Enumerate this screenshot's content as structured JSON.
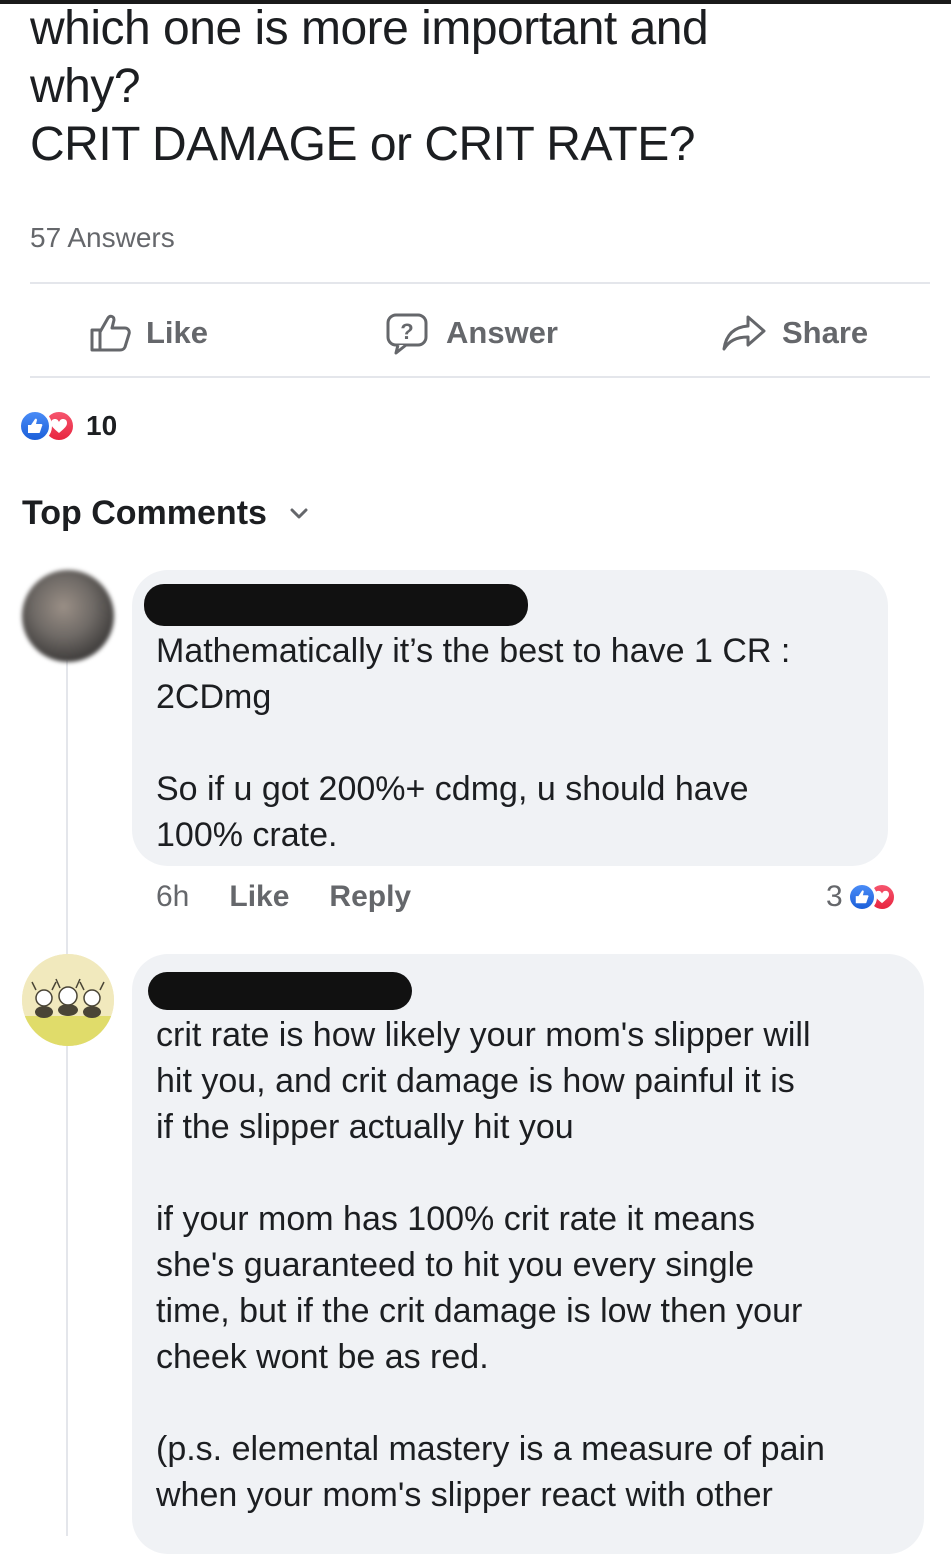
{
  "post": {
    "question_lines": [
      "which one is more important and",
      "why?",
      "CRIT DAMAGE or CRIT RATE?"
    ],
    "answers_count": "57 Answers"
  },
  "actions": {
    "like_label": "Like",
    "answer_label": "Answer",
    "share_label": "Share"
  },
  "reactions": {
    "icons": [
      "like-icon",
      "love-icon"
    ],
    "count": "10"
  },
  "comments_header": {
    "label": "Top Comments",
    "icon": "chevron-down-icon"
  },
  "comments": [
    {
      "author_redacted": true,
      "text": "Mathematically it’s the best to have 1 CR :\n2CDmg\n\nSo if u got 200%+ cdmg, u should have\n100% crate.",
      "time": "6h",
      "like_label": "Like",
      "reply_label": "Reply",
      "reaction_count": "3"
    },
    {
      "author_redacted": true,
      "text": "crit rate is how likely your mom's slipper will\nhit you, and crit damage is how painful it is\nif the slipper actually hit you\n\nif your mom has 100% crit rate it means\nshe's guaranteed to hit you every single\ntime, but if the crit damage is low then your\ncheek wont be as red.\n\n(p.s. elemental mastery is a measure of pain\nwhen your mom's slipper react with other"
    }
  ],
  "colors": {
    "text": "#1c1e21",
    "muted": "#65676b",
    "bubble": "#f0f2f5",
    "like_blue": "#1b5fd9",
    "love_red": "#e8253f"
  }
}
